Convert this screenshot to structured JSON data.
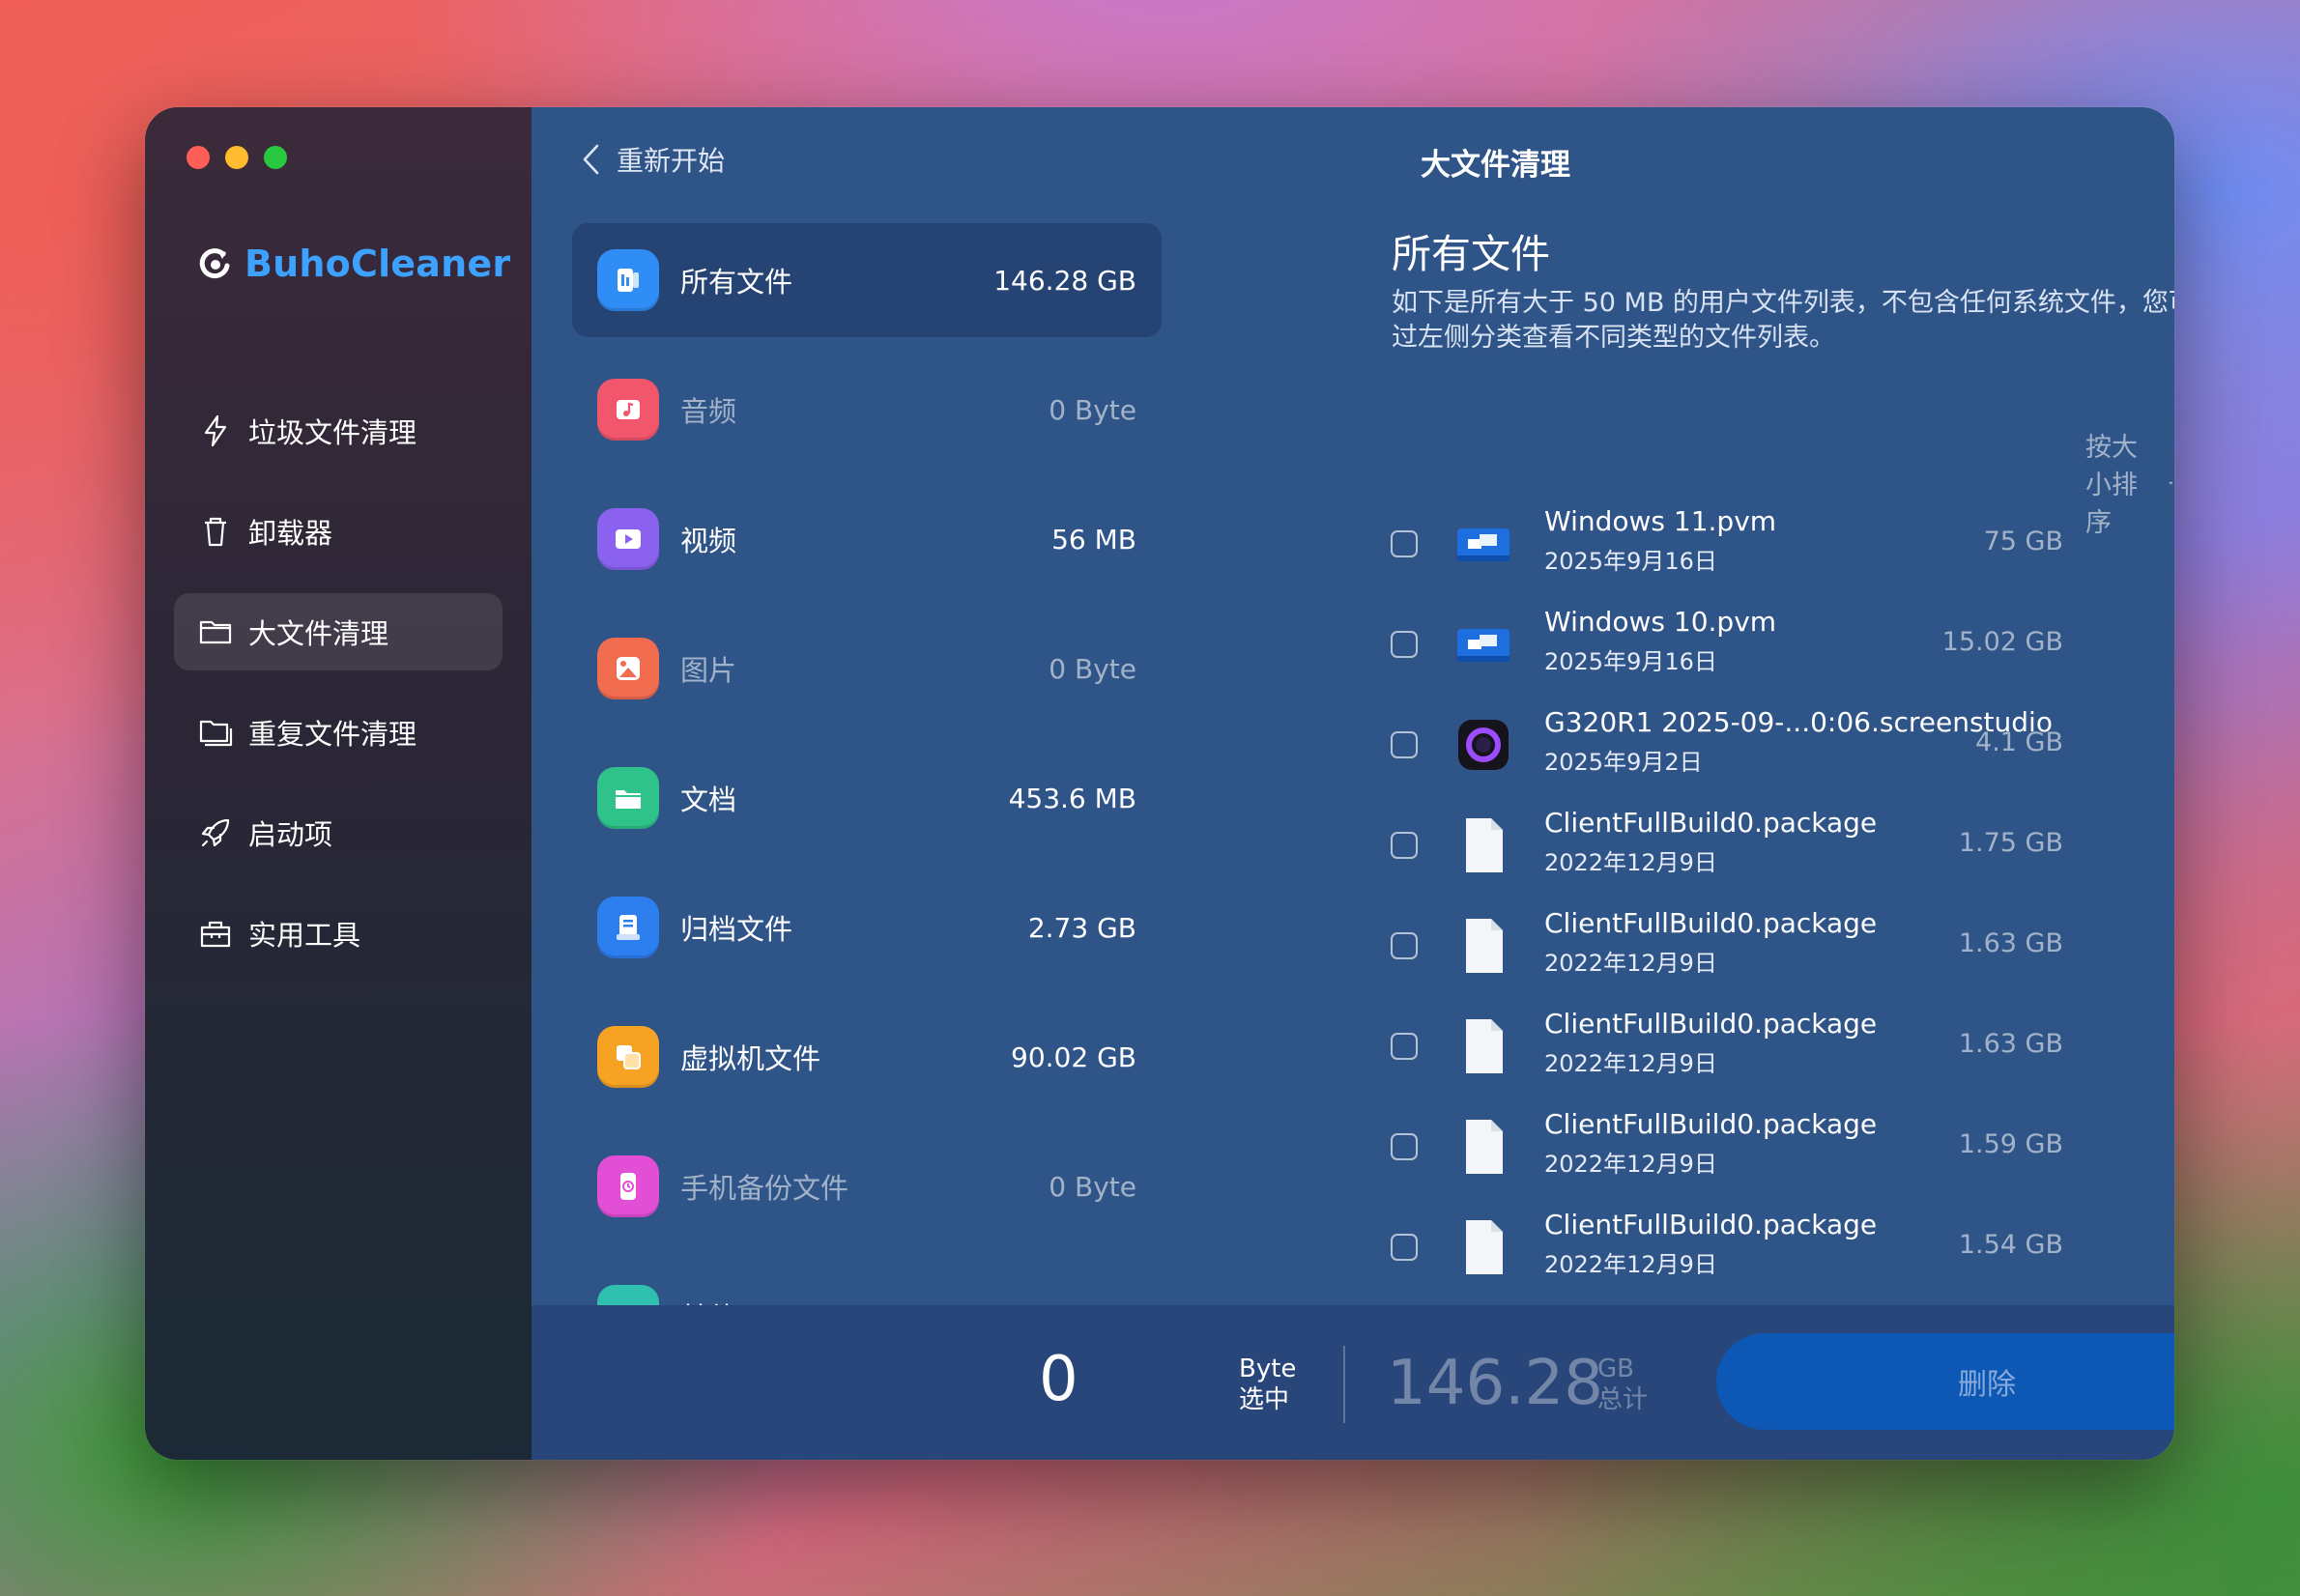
{
  "app": {
    "brand": "BuhoCleaner",
    "window_title": "大文件清理",
    "back_label": "重新开始"
  },
  "sidebar": {
    "items": [
      {
        "label": "垃圾文件清理",
        "icon": "bolt-icon",
        "active": false
      },
      {
        "label": "卸载器",
        "icon": "trash-icon",
        "active": false
      },
      {
        "label": "大文件清理",
        "icon": "folder-icon",
        "active": true
      },
      {
        "label": "重复文件清理",
        "icon": "folders-icon",
        "active": false
      },
      {
        "label": "启动项",
        "icon": "rocket-icon",
        "active": false
      },
      {
        "label": "实用工具",
        "icon": "toolbox-icon",
        "active": false
      }
    ]
  },
  "categories": [
    {
      "name": "所有文件",
      "size": "146.28 GB",
      "icon": "all-files-icon",
      "color": "#2f8df5",
      "active": true,
      "dim": false
    },
    {
      "name": "音频",
      "size": "0 Byte",
      "icon": "audio-icon",
      "color": "#f1566c",
      "active": false,
      "dim": true
    },
    {
      "name": "视频",
      "size": "56 MB",
      "icon": "video-icon",
      "color": "#8b61f0",
      "active": false,
      "dim": false
    },
    {
      "name": "图片",
      "size": "0 Byte",
      "icon": "image-icon",
      "color": "#f26c4f",
      "active": false,
      "dim": true
    },
    {
      "name": "文档",
      "size": "453.6 MB",
      "icon": "document-icon",
      "color": "#2fc28a",
      "active": false,
      "dim": false
    },
    {
      "name": "归档文件",
      "size": "2.73 GB",
      "icon": "archive-icon",
      "color": "#2d7ff0",
      "active": false,
      "dim": false
    },
    {
      "name": "虚拟机文件",
      "size": "90.02 GB",
      "icon": "vm-icon",
      "color": "#f6a324",
      "active": false,
      "dim": false
    },
    {
      "name": "手机备份文件",
      "size": "0 Byte",
      "icon": "phone-backup-icon",
      "color": "#e24ed6",
      "active": false,
      "dim": true
    },
    {
      "name": "其他",
      "size": "",
      "icon": "other-icon",
      "color": "#2fc0b0",
      "active": false,
      "dim": false
    }
  ],
  "detail": {
    "title": "所有文件",
    "description": "如下是所有大于 50 MB 的用户文件列表，不包含任何系统文件，您可以通过左侧分类查看不同类型的文件列表。",
    "sort_label": "按大小排序"
  },
  "files": [
    {
      "name": "Windows 11.pvm",
      "date": "2025年9月16日",
      "size": "75 GB",
      "icon": "parallels-icon"
    },
    {
      "name": "Windows 10.pvm",
      "date": "2025年9月16日",
      "size": "15.02 GB",
      "icon": "parallels-icon"
    },
    {
      "name": "G320R1 2025-09-...0:06.screenstudio",
      "date": "2025年9月2日",
      "size": "4.1 GB",
      "icon": "screenstudio-icon"
    },
    {
      "name": "ClientFullBuild0.package",
      "date": "2022年12月9日",
      "size": "1.75 GB",
      "icon": "file-icon"
    },
    {
      "name": "ClientFullBuild0.package",
      "date": "2022年12月9日",
      "size": "1.63 GB",
      "icon": "file-icon"
    },
    {
      "name": "ClientFullBuild0.package",
      "date": "2022年12月9日",
      "size": "1.63 GB",
      "icon": "file-icon"
    },
    {
      "name": "ClientFullBuild0.package",
      "date": "2022年12月9日",
      "size": "1.59 GB",
      "icon": "file-icon"
    },
    {
      "name": "ClientFullBuild0.package",
      "date": "2022年12月9日",
      "size": "1.54 GB",
      "icon": "file-icon"
    }
  ],
  "footer": {
    "selected_value": "0",
    "selected_unit": "Byte",
    "selected_label": "选中",
    "total_value": "146.28",
    "total_unit": "GB",
    "total_label": "总计",
    "delete_label": "删除"
  }
}
